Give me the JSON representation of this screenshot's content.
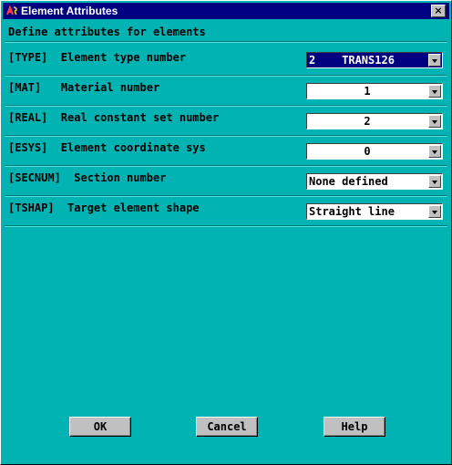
{
  "window": {
    "title": "Element Attributes",
    "close_glyph": "×"
  },
  "header": "Define attributes for elements",
  "rows": [
    {
      "label": "[TYPE]  Element type number",
      "value": "2    TRANS126",
      "selected": true
    },
    {
      "label": "[MAT]   Material number",
      "value": "1"
    },
    {
      "label": "[REAL]  Real constant set number",
      "value": "2"
    },
    {
      "label": "[ESYS]  Element coordinate sys",
      "value": "0"
    },
    {
      "label": "[SECNUM]  Section number",
      "value": "None defined"
    },
    {
      "label": "[TSHAP]  Target element shape",
      "value": "Straight line"
    }
  ],
  "buttons": {
    "ok": "OK",
    "cancel": "Cancel",
    "help": "Help"
  },
  "colors": {
    "background": "#00b3b3",
    "titlebar": "#000080",
    "button_face": "#c0c0c0"
  }
}
